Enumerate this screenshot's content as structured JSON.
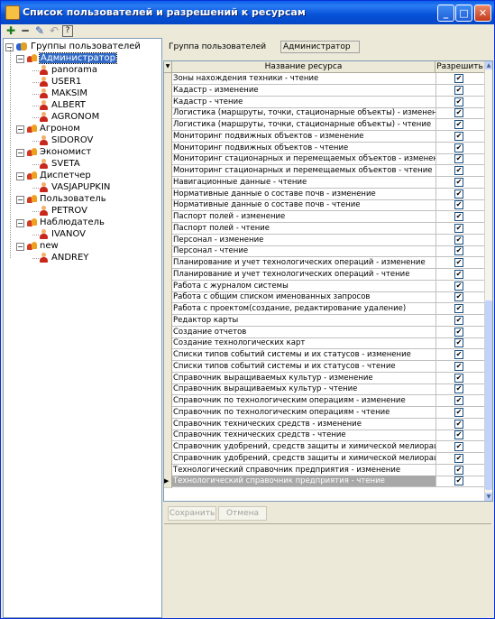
{
  "window": {
    "title": "Список пользователей и разрешений к ресурсам",
    "controls": {
      "minimize": "_",
      "maximize": "□",
      "close": "✕"
    }
  },
  "toolbar": {
    "icons": [
      "add-icon",
      "remove-icon",
      "edit-icon",
      "undo-icon",
      "help-icon"
    ],
    "add_glyph": "✚",
    "remove_glyph": "━",
    "edit_glyph": "✎",
    "undo_glyph": "↶",
    "help_glyph": "?"
  },
  "tree": {
    "root": "Группы пользователей",
    "groups": [
      {
        "name": "Администратор",
        "selected": true,
        "users": [
          "panorama",
          "USER1",
          "MAKSIM",
          "ALBERT",
          "AGRONOM"
        ]
      },
      {
        "name": "Агроном",
        "users": [
          "SIDOROV"
        ]
      },
      {
        "name": "Экономист",
        "users": [
          "SVETA"
        ]
      },
      {
        "name": "Диспетчер",
        "users": [
          "VASJAPUPKIN"
        ]
      },
      {
        "name": "Пользователь",
        "users": [
          "PETROV"
        ]
      },
      {
        "name": "Наблюдатель",
        "users": [
          "IVANOV"
        ]
      },
      {
        "name": "new",
        "users": [
          "ANDREY"
        ]
      }
    ]
  },
  "details": {
    "group_label": "Группа пользователей",
    "group_value": "Администратор"
  },
  "grid": {
    "columns": {
      "name": "Название ресурса",
      "allow": "Разрешить"
    },
    "rows": [
      "Зоны нахождения техники - чтение",
      "Кадастр - изменение",
      "Кадастр - чтение",
      "Логистика (маршруты, точки, стационарные объекты) - изменение",
      "Логистика (маршруты, точки, стационарные объекты) - чтение",
      "Мониторинг подвижных объектов - изменение",
      "Мониторинг подвижных объектов - чтение",
      "Мониторинг стационарных и перемещаемых объектов - изменение",
      "Мониторинг стационарных и перемещаемых объектов - чтение",
      "Навигационные данные - чтение",
      "Нормативные данные о составе почв - изменение",
      "Нормативные данные о составе почв - чтение",
      "Паспорт полей - изменение",
      "Паспорт полей - чтение",
      "Персонал - изменение",
      "Персонал - чтение",
      "Планирование и учет технологических операций - изменение",
      "Планирование и учет технологических операций - чтение",
      "Работа с журналом системы",
      "Работа с общим списком именованных запросов",
      "Работа с проектом(создание, редактирование удаление)",
      "Редактор карты",
      "Создание отчетов",
      "Создание технологических карт",
      "Списки типов событий системы и их статусов - изменение",
      "Списки типов событий системы и их статусов - чтение",
      "Справочник выращиваемых культур - изменение",
      "Справочник выращиваемых культур - чтение",
      "Справочник по технологическим операциям - изменение",
      "Справочник по технологическим операциям - чтение",
      "Справочник технических средств - изменение",
      "Справочник технических средств - чтение",
      "Справочник удобрений, средств защиты и химической мелиорации - изменение",
      "Справочник удобрений, средств защиты и химической мелиорации - чтение",
      "Технологический справочник предприятия - изменение",
      "Технологический справочник предприятия - чтение"
    ],
    "current_row_index": 35,
    "check_glyph": "✔"
  },
  "buttons": {
    "save": "Сохранить",
    "cancel": "Отмена"
  }
}
